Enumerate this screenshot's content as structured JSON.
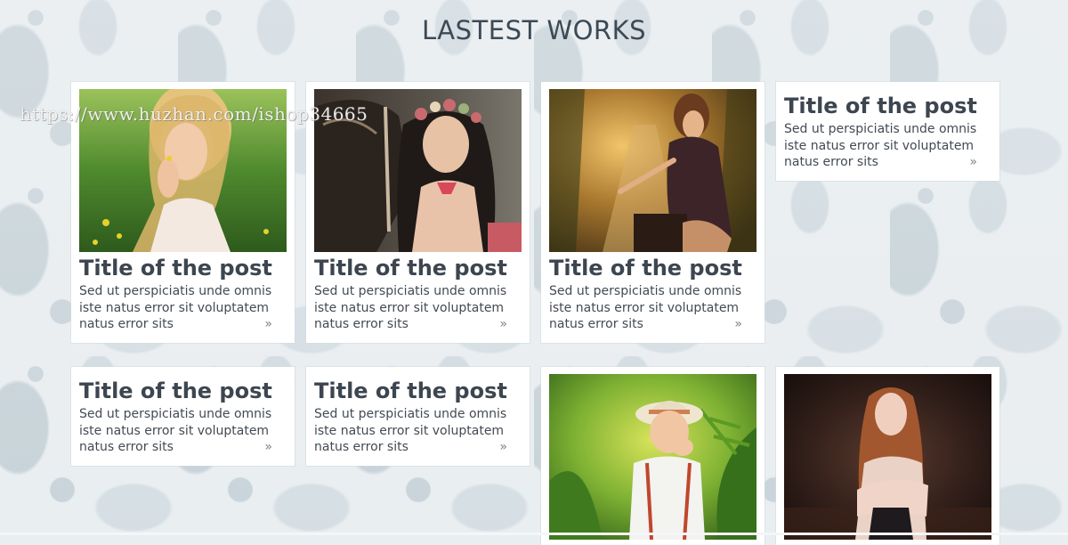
{
  "section": {
    "title": "LASTEST WORKS"
  },
  "watermark": "https://www.huzhan.com/ishop34665",
  "colors": {
    "title_text": "#3d4650",
    "body_text": "#434a52",
    "card_bg": "#ffffff",
    "page_bg": "#e8edf0"
  },
  "posts": [
    {
      "title": "Title of the post",
      "excerpt": "Sed ut perspiciatis unde omnis iste natus error sit voluptatem natus error sits",
      "more_icon": "»",
      "image": "woman-in-grass-photo"
    },
    {
      "title": "Title of the post",
      "excerpt": "Sed ut perspiciatis unde omnis iste natus error sit voluptatem natus error sits",
      "more_icon": "»",
      "image": "woman-with-horse-photo"
    },
    {
      "title": "Title of the post",
      "excerpt": "Sed ut perspiciatis unde omnis iste natus error sit voluptatem natus error sits",
      "more_icon": "»",
      "image": "woman-on-path-photo"
    },
    {
      "title": "Title of the post",
      "excerpt": "Sed ut perspiciatis unde omnis iste natus error sit voluptatem natus error sits",
      "more_icon": "»"
    },
    {
      "title": "Title of the post",
      "excerpt": "Sed ut perspiciatis unde omnis iste natus error sit voluptatem natus error sits",
      "more_icon": "»"
    },
    {
      "title": "Title of the post",
      "excerpt": "Sed ut perspiciatis unde omnis iste natus error sit voluptatem natus error sits",
      "more_icon": "»"
    },
    {
      "image": "child-in-ferns-photo"
    },
    {
      "image": "woman-dark-background-photo"
    }
  ]
}
